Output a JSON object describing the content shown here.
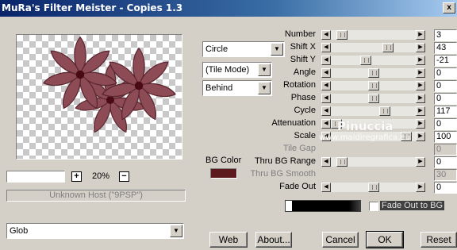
{
  "window": {
    "title": "MuRa's Filter Meister - Copies 1.3",
    "close_glyph": "x"
  },
  "zoom": {
    "value": "20%",
    "plus": "+",
    "minus": "−"
  },
  "host_status": "Unknown Host (\"9PSP\")",
  "combos": {
    "shape": "Circle",
    "tile_mode": "(Tile Mode)",
    "order": "Behind",
    "preset": "Glob"
  },
  "bg_color": {
    "label": "BG Color",
    "color": "#5c1a1e"
  },
  "params": [
    {
      "label": "Number",
      "value": "3",
      "thumb": 0.08,
      "enabled": true
    },
    {
      "label": "Shift X",
      "value": "43",
      "thumb": 0.7,
      "enabled": true
    },
    {
      "label": "Shift Y",
      "value": "-21",
      "thumb": 0.4,
      "enabled": true
    },
    {
      "label": "Angle",
      "value": "0",
      "thumb": 0.5,
      "enabled": true
    },
    {
      "label": "Rotation",
      "value": "0",
      "thumb": 0.5,
      "enabled": true
    },
    {
      "label": "Phase",
      "value": "0",
      "thumb": 0.5,
      "enabled": true
    },
    {
      "label": "Cycle",
      "value": "117",
      "thumb": 0.66,
      "enabled": true
    },
    {
      "label": "Attenuation",
      "value": "0",
      "thumb": 0.0,
      "enabled": true
    },
    {
      "label": "Scale",
      "value": "100",
      "thumb": 0.95,
      "enabled": true
    },
    {
      "label": "Tile Gap",
      "value": "0",
      "thumb": null,
      "enabled": false
    },
    {
      "label": "Thru BG Range",
      "value": "0",
      "thumb": 0.08,
      "enabled": true
    },
    {
      "label": "Thru BG Smooth",
      "value": "30",
      "thumb": null,
      "enabled": false
    },
    {
      "label": "Fade Out",
      "value": "0",
      "thumb": 0.5,
      "enabled": true
    }
  ],
  "fade_out_to_bg": {
    "label": "Fade Out to BG",
    "checked": false
  },
  "watermark": {
    "line1": "Pinuccia",
    "line2": "www.maidiregrafica.eu"
  },
  "buttons": {
    "web": "Web",
    "about": "About...",
    "cancel": "Cancel",
    "ok": "OK",
    "reset": "Reset"
  },
  "arrows": {
    "left": "◀",
    "right": "▶",
    "down": "▼"
  }
}
